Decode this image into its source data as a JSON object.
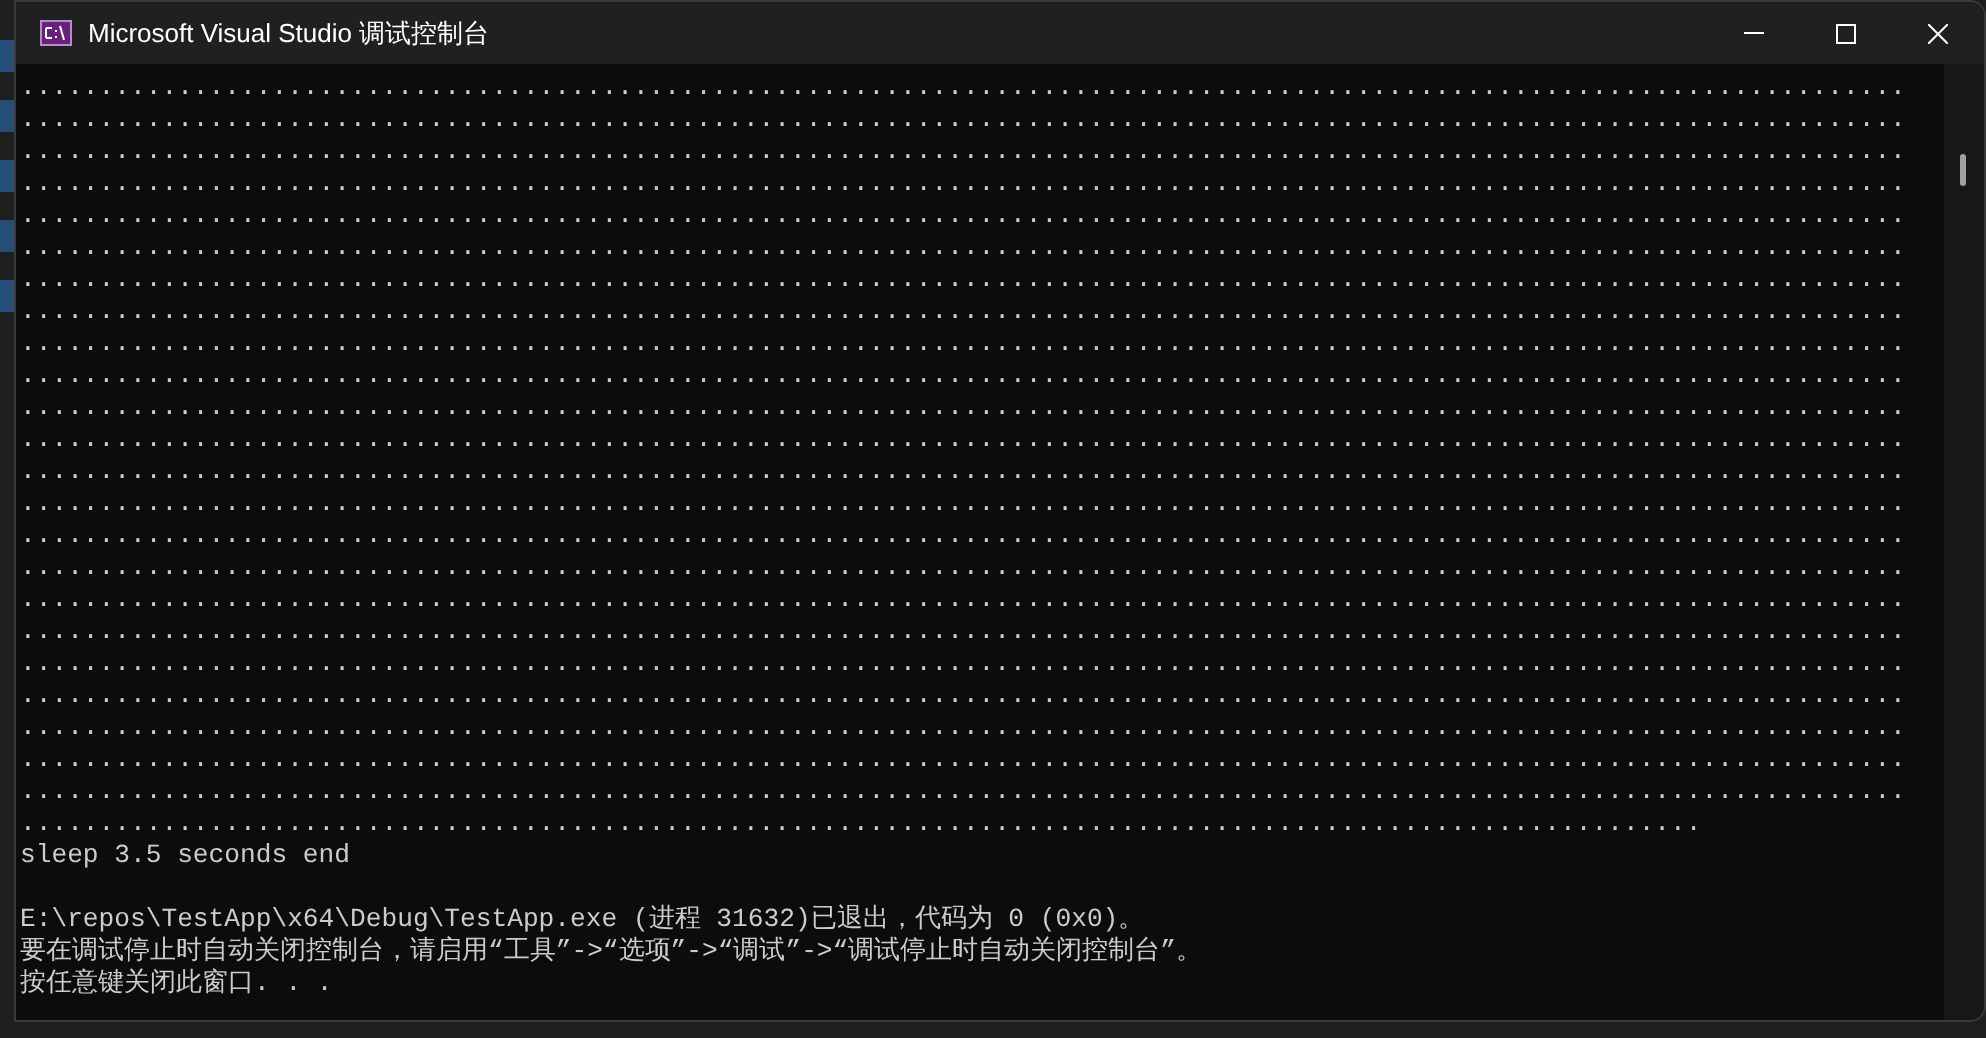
{
  "window": {
    "title": "Microsoft Visual Studio 调试控制台"
  },
  "console": {
    "output_lines": [
      "........................................................................................................................",
      "........................................................................................................................",
      "........................................................................................................................",
      "........................................................................................................................",
      "........................................................................................................................",
      "........................................................................................................................",
      "........................................................................................................................",
      "........................................................................................................................",
      "........................................................................................................................",
      "........................................................................................................................",
      "........................................................................................................................",
      "........................................................................................................................",
      "........................................................................................................................",
      "........................................................................................................................",
      "........................................................................................................................",
      "........................................................................................................................",
      "........................................................................................................................",
      "........................................................................................................................",
      "........................................................................................................................",
      "........................................................................................................................",
      "........................................................................................................................",
      "........................................................................................................................",
      "........................................................................................................................",
      "...........................................................................................................",
      "sleep 3.5 seconds end"
    ],
    "exit_messages": [
      "E:\\repos\\TestApp\\x64\\Debug\\TestApp.exe (进程 31632)已退出，代码为 0 (0x0)。",
      "要在调试停止时自动关闭控制台，请启用“工具”->“选项”->“调试”->“调试停止时自动关闭控制台”。",
      "按任意键关闭此窗口. . ."
    ]
  }
}
